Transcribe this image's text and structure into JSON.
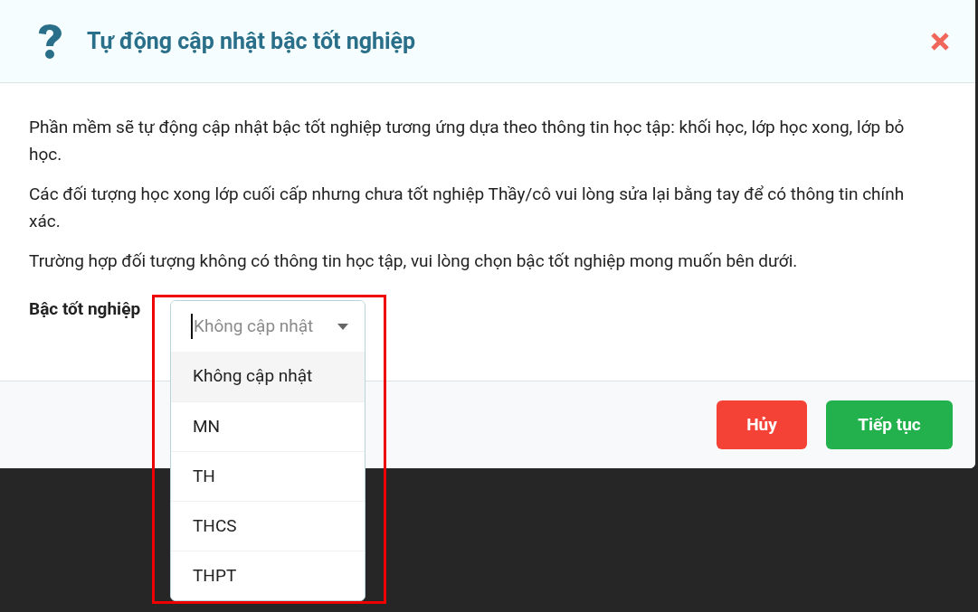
{
  "dialog": {
    "title": "Tự động cập nhật bậc tốt nghiệp",
    "paragraphs": [
      "Phần mềm sẽ tự động cập nhật bậc tốt nghiệp tương ứng dựa theo thông tin học tập: khối học, lớp học xong, lớp bỏ học.",
      "Các đối tượng học xong lớp cuối cấp nhưng chưa tốt nghiệp Thầy/cô vui lòng sửa lại bằng tay để có thông tin chính xác.",
      "Trường hợp đối tượng không có thông tin học tập, vui lòng chọn bậc tốt nghiệp mong muốn bên dưới."
    ],
    "field": {
      "label": "Bậc tốt nghiệp",
      "placeholder": "Không cập nhật",
      "expanded": true,
      "options": [
        {
          "label": "Không cập nhật",
          "selected": true
        },
        {
          "label": "MN",
          "selected": false
        },
        {
          "label": "TH",
          "selected": false
        },
        {
          "label": "THCS",
          "selected": false
        },
        {
          "label": "THPT",
          "selected": false
        }
      ]
    },
    "buttons": [
      {
        "label": "Hủy",
        "kind": "cancel"
      },
      {
        "label": "Tiếp tục",
        "kind": "confirm"
      }
    ]
  }
}
